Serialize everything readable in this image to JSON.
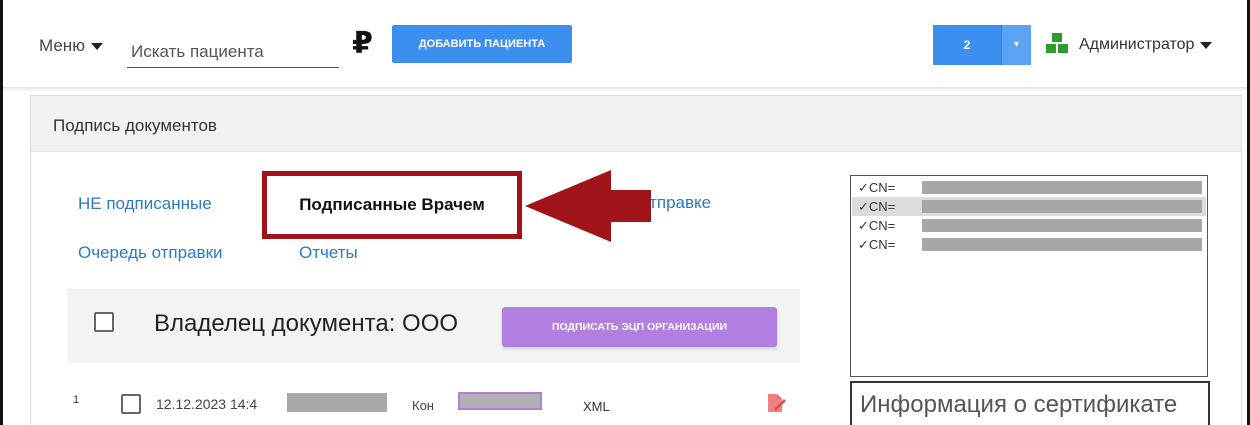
{
  "topbar": {
    "menu_label": "Меню",
    "search_placeholder": "Искать пациента",
    "currency_symbol": "₽",
    "add_patient_label": "ДОБАВИТЬ ПАЦИЕНТА",
    "counter_value": "2",
    "user_name": "Администратор"
  },
  "panel": {
    "title": "Подпись документов"
  },
  "tabs": {
    "unsigned": "НЕ подписанные",
    "signed_by_doctor": "Подписанные Врачем",
    "ready_to_send_partial": "отправке",
    "send_queue": "Очередь отправки",
    "reports": "Отчеты"
  },
  "owner_section": {
    "title": "Владелец документа: ООО",
    "sign_org_label": "ПОДПИСАТЬ ЭЦП ОРГАНИЗАЦИИ"
  },
  "rows": [
    {
      "num": "1",
      "date": "12.12.2023 14:4",
      "type_partial": "Кон",
      "format": "XML"
    }
  ],
  "certificates": {
    "items": [
      {
        "label": "✓CN="
      },
      {
        "label": "✓CN="
      },
      {
        "label": "✓CN="
      },
      {
        "label": "✓CN="
      }
    ],
    "info_title": "Информация о сертификате"
  },
  "colors": {
    "primary_button": "#3d8fef",
    "purple_button": "#b27fe0",
    "highlight_border": "#a01318",
    "link": "#2a7ac6",
    "user_icon": "#2e9b2e"
  },
  "icons": {
    "menu_caret": "chevron-down-icon",
    "user": "users-group-icon",
    "doc": "sign-document-icon",
    "annotation": "arrow-left-icon"
  }
}
